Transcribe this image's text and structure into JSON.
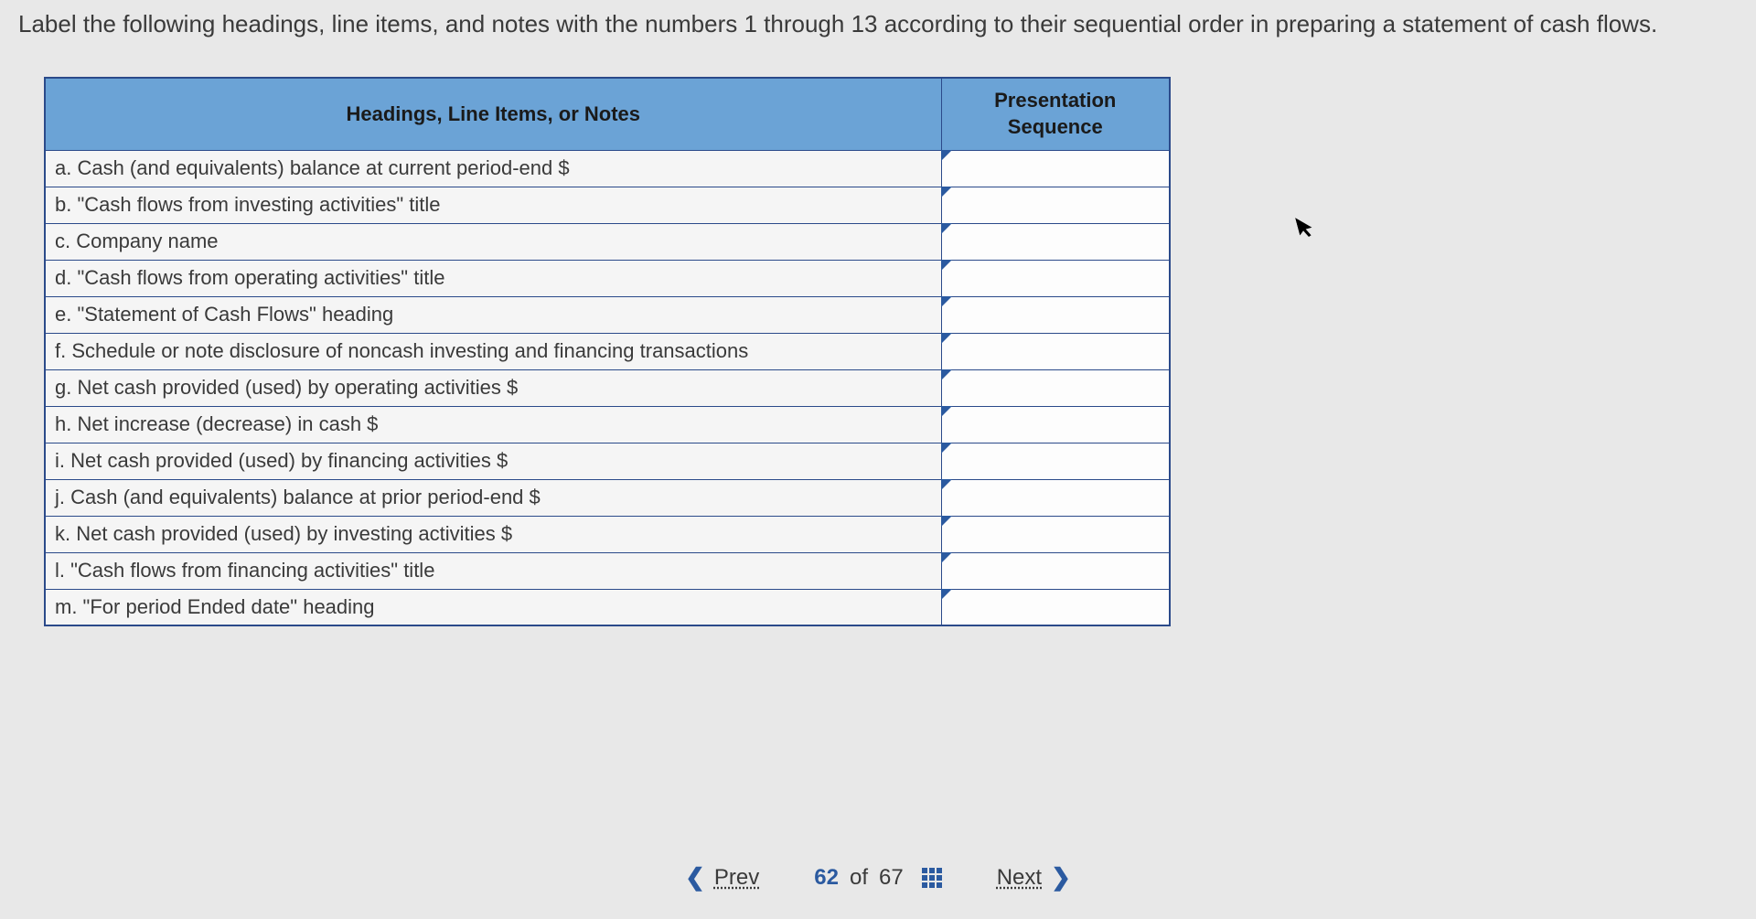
{
  "instruction": "Label the following headings, line items, and notes with the numbers 1 through 13 according to their sequential order in preparing a statement of cash flows.",
  "table": {
    "header_col1": "Headings, Line Items, or Notes",
    "header_col2": "Presentation Sequence",
    "rows": [
      {
        "label": "a. Cash (and equivalents) balance at current period-end $",
        "value": ""
      },
      {
        "label": "b. \"Cash flows from investing activities\" title",
        "value": ""
      },
      {
        "label": "c. Company name",
        "value": ""
      },
      {
        "label": "d. \"Cash flows from operating activities\" title",
        "value": ""
      },
      {
        "label": "e. \"Statement of Cash Flows\" heading",
        "value": ""
      },
      {
        "label": "f. Schedule or note disclosure of noncash investing and financing transactions",
        "value": ""
      },
      {
        "label": "g. Net cash provided (used) by operating activities $",
        "value": ""
      },
      {
        "label": "h. Net increase (decrease) in cash $",
        "value": ""
      },
      {
        "label": "i. Net cash provided (used) by financing activities $",
        "value": ""
      },
      {
        "label": "j. Cash (and equivalents) balance at prior period-end $",
        "value": ""
      },
      {
        "label": "k. Net cash provided (used) by investing activities $",
        "value": ""
      },
      {
        "label": "l. \"Cash flows from financing activities\" title",
        "value": ""
      },
      {
        "label": "m. \"For period Ended date\" heading",
        "value": ""
      }
    ]
  },
  "nav": {
    "prev": "Prev",
    "next": "Next",
    "current": "62",
    "of": "of",
    "total": "67"
  }
}
